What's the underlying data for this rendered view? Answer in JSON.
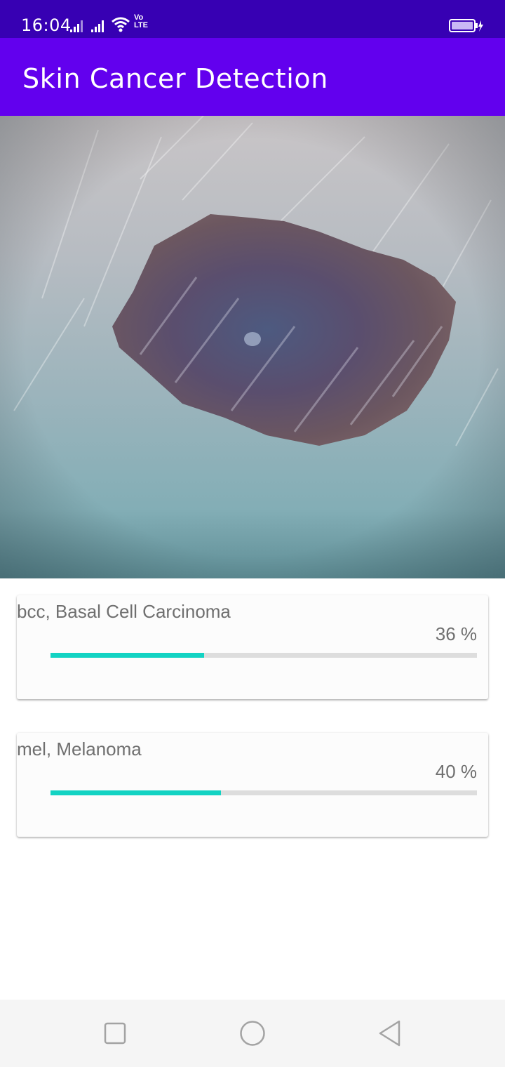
{
  "status_bar": {
    "time": "16:04",
    "signal_label": "LTE",
    "icons": [
      "signal-1-icon",
      "signal-2-icon",
      "wifi-icon",
      "volte-icon",
      "battery-charging-icon"
    ]
  },
  "app_bar": {
    "title": "Skin Cancer Detection"
  },
  "image": {
    "icon": "skin-lesion-photo"
  },
  "results": [
    {
      "label": "bcc, Basal Cell Carcinoma",
      "percent_text": "36 %",
      "value": 0.36
    },
    {
      "label": "mel, Melanoma",
      "percent_text": "40 %",
      "value": 0.4
    }
  ],
  "nav_bar": {
    "icons": [
      "recents-square-icon",
      "home-circle-icon",
      "back-triangle-icon"
    ]
  },
  "colors": {
    "status_bar": "#3700b3",
    "app_bar": "#6200ee",
    "progress": "#13d3c3",
    "track": "#dddddd"
  }
}
